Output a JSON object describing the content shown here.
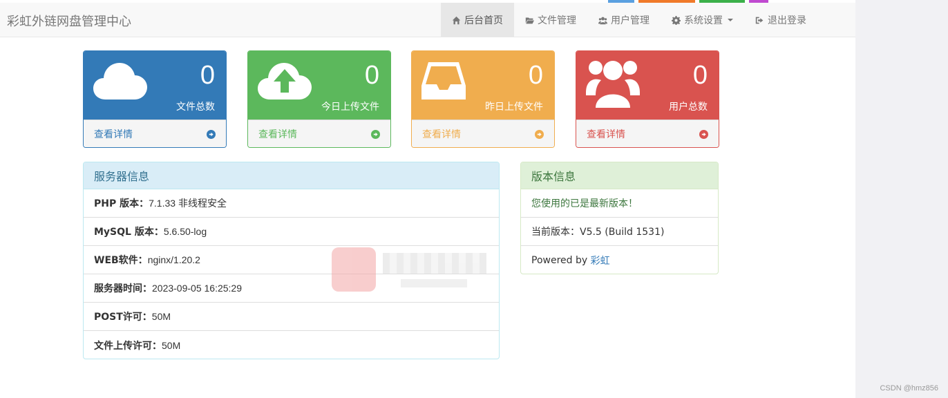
{
  "brand": "彩虹外链网盘管理中心",
  "nav": [
    {
      "label": "后台首页",
      "icon": "home-icon",
      "active": true
    },
    {
      "label": "文件管理",
      "icon": "folder-open-icon",
      "active": false
    },
    {
      "label": "用户管理",
      "icon": "users-icon",
      "active": false
    },
    {
      "label": "系统设置",
      "icon": "gear-icon",
      "active": false,
      "dropdown": true
    },
    {
      "label": "退出登录",
      "icon": "logout-icon",
      "active": false
    }
  ],
  "stats": [
    {
      "value": "0",
      "label": "文件总数",
      "link": "查看详情",
      "icon": "cloud-icon",
      "color": "#337ab7"
    },
    {
      "value": "0",
      "label": "今日上传文件",
      "link": "查看详情",
      "icon": "cloud-upload-icon",
      "color": "#5cb85c"
    },
    {
      "value": "0",
      "label": "昨日上传文件",
      "link": "查看详情",
      "icon": "inbox-icon",
      "color": "#f0ad4e"
    },
    {
      "value": "0",
      "label": "用户总数",
      "link": "查看详情",
      "icon": "users-icon",
      "color": "#d9534f"
    }
  ],
  "server": {
    "title": "服务器信息",
    "rows": [
      {
        "key": "PHP 版本：",
        "value": "7.1.33 非线程安全"
      },
      {
        "key": "MySQL 版本：",
        "value": "5.6.50-log"
      },
      {
        "key": "WEB软件：",
        "value": "nginx/1.20.2"
      },
      {
        "key": "服务器时间：",
        "value": "2023-09-05 16:25:29"
      },
      {
        "key": "POST许可：",
        "value": "50M"
      },
      {
        "key": "文件上传许可：",
        "value": "50M"
      }
    ]
  },
  "version": {
    "title": "版本信息",
    "status": "您使用的已是最新版本！",
    "current": "当前版本：V5.5 (Build 1531)",
    "powered_prefix": "Powered by ",
    "powered_link": "彩虹"
  },
  "footer_mark": "CSDN @hmz856"
}
